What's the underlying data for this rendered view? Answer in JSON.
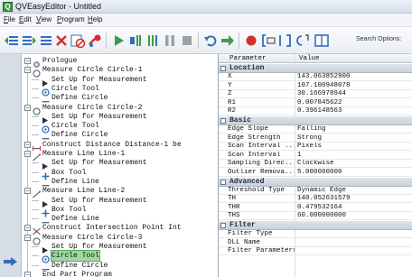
{
  "window": {
    "title": "QVEasyEditor - Untitled"
  },
  "menu": [
    "File",
    "Edit",
    "View",
    "Program",
    "Help"
  ],
  "toolbar": {
    "search_label": "Search Options:",
    "buttons": [
      "align-left-icon",
      "align-right-icon",
      "list-icon",
      "x-icon",
      "no-entry-icon",
      "link-icon",
      "play-icon",
      "step-icon",
      "step-over-icon",
      "pause-icon",
      "stop-icon",
      "undo-icon",
      "arrow-right-icon",
      "record-icon",
      "bracket-icon",
      "bracket-alt-icon",
      "bracket-c-icon",
      "panel-icon"
    ]
  },
  "tree": [
    {
      "text": "Prologue",
      "indent": 0,
      "icon": "gear-icon"
    },
    {
      "text": "Measure Circle Circle-1",
      "indent": 0,
      "icon": "circle-icon"
    },
    {
      "text": "Set Up for Measurement",
      "indent": 1,
      "icon": "setup-icon"
    },
    {
      "text": "Circle Tool",
      "indent": 1,
      "icon": "circle-tool-icon"
    },
    {
      "text": "Define Circle",
      "indent": 1,
      "icon": "dash-icon"
    },
    {
      "text": "Measure Circle Circle-2",
      "indent": 0,
      "icon": "circle-icon"
    },
    {
      "text": "Set Up for Measurement",
      "indent": 1,
      "icon": "setup-icon"
    },
    {
      "text": "Circle Tool",
      "indent": 1,
      "icon": "circle-tool-icon"
    },
    {
      "text": "Define Circle",
      "indent": 1,
      "icon": "dash-icon"
    },
    {
      "text": "Construct Distance Distance-1 be",
      "indent": 0,
      "icon": "distance-icon"
    },
    {
      "text": "Measure Line Line-1",
      "indent": 0,
      "icon": "line-icon"
    },
    {
      "text": "Set Up for Measurement",
      "indent": 1,
      "icon": "setup-icon"
    },
    {
      "text": "Box Tool",
      "indent": 1,
      "icon": "box-tool-icon"
    },
    {
      "text": "Define Line",
      "indent": 1,
      "icon": "dash-icon"
    },
    {
      "text": "Measure Line Line-2",
      "indent": 0,
      "icon": "line-icon"
    },
    {
      "text": "Set Up for Measurement",
      "indent": 1,
      "icon": "setup-icon"
    },
    {
      "text": "Box Tool",
      "indent": 1,
      "icon": "box-tool-icon"
    },
    {
      "text": "Define Line",
      "indent": 1,
      "icon": "dash-icon"
    },
    {
      "text": "Construct Intersection Point Int",
      "indent": 0,
      "icon": "intersection-icon"
    },
    {
      "text": "Measure Circle Circle-3",
      "indent": 0,
      "icon": "circle-icon"
    },
    {
      "text": "Set Up for Measurement",
      "indent": 1,
      "icon": "setup-icon"
    },
    {
      "text": "Circle Tool",
      "indent": 1,
      "icon": "circle-tool-icon",
      "selected": true
    },
    {
      "text": "Define Circle",
      "indent": 1,
      "icon": "dash-icon"
    },
    {
      "text": "End Part Program",
      "indent": 0,
      "icon": "dash-icon"
    }
  ],
  "grid": {
    "col_param": "Parameter",
    "col_value": "Value",
    "rows": [
      {
        "cat": "Location"
      },
      {
        "k": "X",
        "v": "143.063852900"
      },
      {
        "k": "Y",
        "v": "107.100948078"
      },
      {
        "k": "Z",
        "v": "30.166978944"
      },
      {
        "k": "R1",
        "v": "0.007845622"
      },
      {
        "k": "R2",
        "v": "0.396148563"
      },
      {
        "cat": "Basic"
      },
      {
        "k": "Edge Slope",
        "v": "Falling"
      },
      {
        "k": "Edge Strength",
        "v": "Strong"
      },
      {
        "k": "Scan Interval ...",
        "v": "Pixels"
      },
      {
        "k": "Scan Interval",
        "v": "1"
      },
      {
        "k": "Sampling Direc...",
        "v": "Clockwise"
      },
      {
        "k": "Outlier Remova...",
        "v": "5.000000000"
      },
      {
        "cat": "Advanced"
      },
      {
        "k": "Threshold Type",
        "v": "Dynamic Edge"
      },
      {
        "k": "TH",
        "v": "140.052631579"
      },
      {
        "k": "THR",
        "v": "0.479532164"
      },
      {
        "k": "THS",
        "v": "60.000000000"
      },
      {
        "cat": "Filter"
      },
      {
        "k": "Filter Type",
        "v": ""
      },
      {
        "k": "DLL Name",
        "v": ""
      },
      {
        "k": "Filter Parameters",
        "v": ""
      }
    ]
  },
  "colors": {
    "selected": "#9fd8a0",
    "accent_green": "#3f9b44",
    "accent_red": "#d32f2f",
    "grid_header": "#c8d0da"
  }
}
